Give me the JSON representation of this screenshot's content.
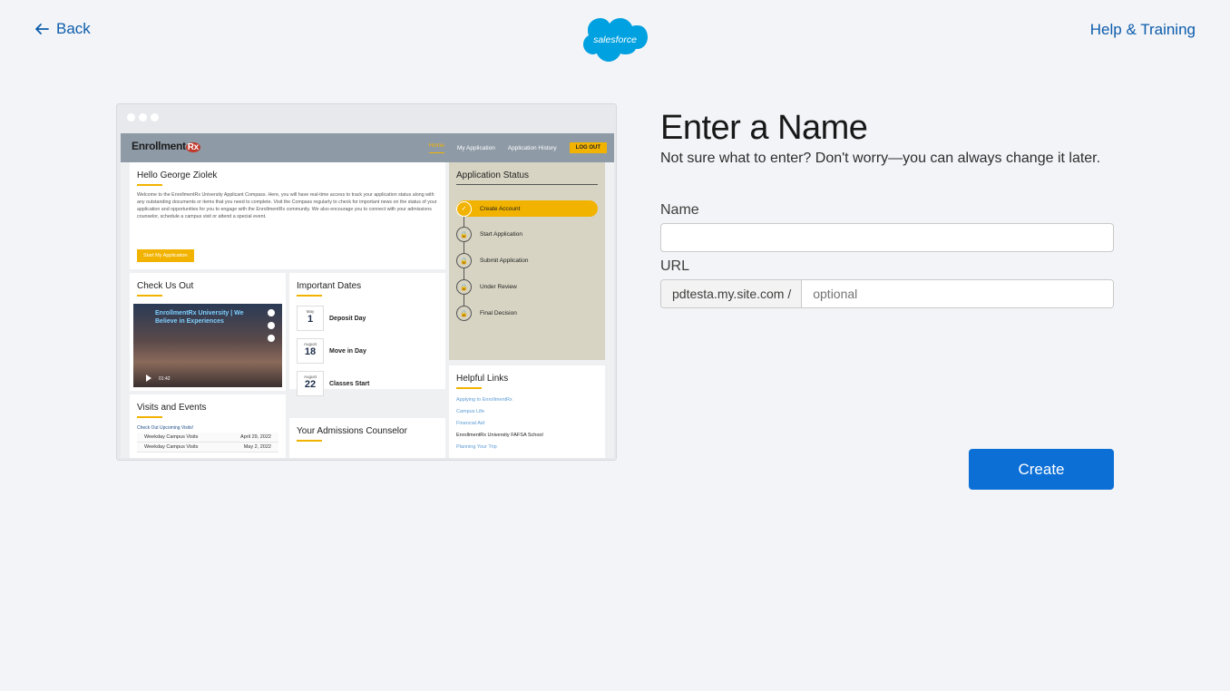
{
  "nav": {
    "back_label": "Back",
    "help_label": "Help & Training",
    "logo_text": "salesforce"
  },
  "preview": {
    "site_logo": "Enrollment",
    "site_logo_rx": "Rx",
    "nav_items": [
      "Home",
      "My Application",
      "Application History"
    ],
    "logout_label": "LOG OUT",
    "hello": {
      "title": "Hello George Ziolek",
      "body": "Welcome to the EnrollmentRx University Applicant Compass. Here, you will have real-time access to track your application status along with any outstanding documents or items that you need to complete. Visit the Compass regularly to check for important news on the status of your application and opportunities for you to engage with the EnrollmentRx community. We also encourage you to connect with your admissions counselor, schedule a campus visit or attend a special event.",
      "button": "Start My Application"
    },
    "status": {
      "title": "Application Status",
      "steps": [
        "Create Account",
        "Start Application",
        "Submit Application",
        "Under Review",
        "Final Decision"
      ]
    },
    "check_us_out": {
      "title": "Check Us Out",
      "video_title": "EnrollmentRx University | We Believe in Experiences",
      "video_time": "01:42"
    },
    "important_dates": {
      "title": "Important Dates",
      "items": [
        {
          "month": "May",
          "day": "1",
          "label": "Deposit Day"
        },
        {
          "month": "August",
          "day": "18",
          "label": "Move in Day"
        },
        {
          "month": "August",
          "day": "22",
          "label": "Classes Start"
        }
      ]
    },
    "helpful_links": {
      "title": "Helpful Links",
      "items": [
        "Applying to EnrollmentRx",
        "Campus Life",
        "Financial Aid",
        "EnrollmentRx University FAFSA School",
        "Planning Your Trip"
      ]
    },
    "visits": {
      "title": "Visits and Events",
      "subtitle": "Check Out Upcoming Visits!",
      "rows": [
        {
          "name": "Weekday Campus Visits",
          "date": "April 29, 2022"
        },
        {
          "name": "Weekday Campus Visits",
          "date": "May 2, 2022"
        }
      ]
    },
    "counselor": {
      "title": "Your Admissions Counselor"
    }
  },
  "form": {
    "title": "Enter a Name",
    "subtitle": "Not sure what to enter? Don't worry—you can always change it later.",
    "name_label": "Name",
    "name_value": "",
    "url_label": "URL",
    "url_prefix": "pdtesta.my.site.com /",
    "url_placeholder": "optional",
    "create_label": "Create"
  },
  "colors": {
    "link": "#0b5cab",
    "primary_button": "#0b6fd6",
    "accent": "#f2b300",
    "background": "#f3f4f8"
  }
}
